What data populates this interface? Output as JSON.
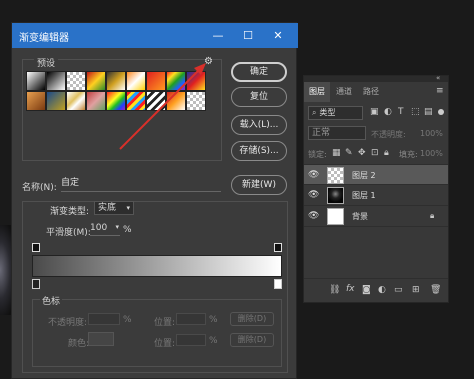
{
  "dialog": {
    "title": "渐变编辑器",
    "window_controls": {
      "minimize": "—",
      "maximize": "☐",
      "close": "✕"
    },
    "presets_label": "预设",
    "buttons": {
      "ok": "确定",
      "reset": "复位",
      "load": "载入(L)...",
      "save": "存储(S)...",
      "new": "新建(W)"
    },
    "name_label": "名称(N):",
    "name_value": "自定",
    "gradient_type_label": "渐变类型:",
    "gradient_type_value": "实底",
    "smoothness_label": "平滑度(M):",
    "smoothness_value": "100",
    "smoothness_unit": "%",
    "color_stops_label": "色标",
    "opacity_label": "不透明度:",
    "opacity_unit": "%",
    "location_label": "位置:",
    "location_unit": "%",
    "delete_label": "删除(D)",
    "color_label": "颜色:"
  },
  "layers_panel": {
    "tabs": [
      "图层",
      "通道",
      "路径"
    ],
    "menu_glyph": "≡",
    "collapse_glyph": "«",
    "kind_filter": "类型",
    "blend_mode": "正常",
    "opacity_label": "不透明度:",
    "opacity_value": "100%",
    "lock_label": "锁定:",
    "fill_label": "填充:",
    "fill_value": "100%",
    "layers": [
      {
        "name": "图层 2",
        "selected": true,
        "thumb": "transparent"
      },
      {
        "name": "图层 1",
        "selected": false,
        "thumb": "dark-image"
      },
      {
        "name": "背景",
        "selected": false,
        "thumb": "white",
        "locked": true
      }
    ],
    "footer_icons": [
      "link-icon",
      "fx-icon",
      "mask-icon",
      "adjustment-icon",
      "group-icon",
      "new-layer-icon",
      "trash-icon"
    ]
  },
  "colors": {
    "titlebar": "#2a72c8",
    "annotation_arrow": "#d9302a"
  }
}
